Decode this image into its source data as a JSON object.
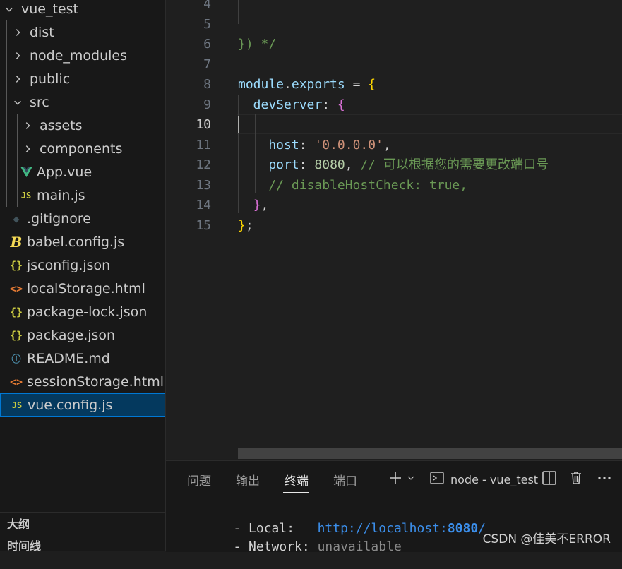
{
  "explorer": {
    "root": "vue_test",
    "items": [
      {
        "label": "dist",
        "type": "folder",
        "icon": "chevron-right-icon"
      },
      {
        "label": "node_modules",
        "type": "folder",
        "icon": "chevron-right-icon"
      },
      {
        "label": "public",
        "type": "folder",
        "icon": "chevron-right-icon"
      },
      {
        "label": "src",
        "type": "folder-open",
        "icon": "chevron-down-icon"
      },
      {
        "label": "assets",
        "type": "folder",
        "icon": "chevron-right-icon"
      },
      {
        "label": "components",
        "type": "folder",
        "icon": "chevron-right-icon"
      },
      {
        "label": "App.vue",
        "type": "file",
        "icon": "vue-file-icon"
      },
      {
        "label": "main.js",
        "type": "file",
        "icon": "js-file-icon",
        "glyph": "JS"
      },
      {
        "label": ".gitignore",
        "type": "file",
        "icon": "git-file-icon",
        "glyph": "◆"
      },
      {
        "label": "babel.config.js",
        "type": "file",
        "icon": "babel-file-icon",
        "glyph": "B"
      },
      {
        "label": "jsconfig.json",
        "type": "file",
        "icon": "json-file-icon",
        "glyph": "{}"
      },
      {
        "label": "localStorage.html",
        "type": "file",
        "icon": "html-file-icon",
        "glyph": "<>"
      },
      {
        "label": "package-lock.json",
        "type": "file",
        "icon": "json-file-icon",
        "glyph": "{}"
      },
      {
        "label": "package.json",
        "type": "file",
        "icon": "json-file-icon",
        "glyph": "{}"
      },
      {
        "label": "README.md",
        "type": "file",
        "icon": "info-file-icon",
        "glyph": "ⓘ"
      },
      {
        "label": "sessionStorage.html",
        "type": "file",
        "icon": "html-file-icon",
        "glyph": "<>"
      },
      {
        "label": "vue.config.js",
        "type": "file",
        "icon": "js-file-icon",
        "glyph": "JS",
        "selected": true
      }
    ],
    "sections": {
      "outline": "大纲",
      "timeline": "时间线"
    }
  },
  "editor": {
    "active_line": "10",
    "lines": [
      {
        "n": "4",
        "tokens": []
      },
      {
        "n": "5",
        "tokens": []
      },
      {
        "n": "6",
        "tokens": [
          {
            "t": "}) */",
            "c": "com"
          }
        ]
      },
      {
        "n": "7",
        "tokens": []
      },
      {
        "n": "8",
        "tokens": [
          {
            "t": "module",
            "c": "var"
          },
          {
            "t": ".",
            "c": "plain"
          },
          {
            "t": "exports",
            "c": "var"
          },
          {
            "t": " = ",
            "c": "op"
          },
          {
            "t": "{",
            "c": "brk1"
          }
        ]
      },
      {
        "n": "9",
        "tokens": [
          {
            "t": "  devServer",
            "c": "prop"
          },
          {
            "t": ": ",
            "c": "plain"
          },
          {
            "t": "{",
            "c": "brk2"
          }
        ]
      },
      {
        "n": "10",
        "tokens": []
      },
      {
        "n": "11",
        "tokens": [
          {
            "t": "    host",
            "c": "prop"
          },
          {
            "t": ": ",
            "c": "plain"
          },
          {
            "t": "'0.0.0.0'",
            "c": "str"
          },
          {
            "t": ",",
            "c": "plain"
          }
        ]
      },
      {
        "n": "12",
        "tokens": [
          {
            "t": "    port",
            "c": "prop"
          },
          {
            "t": ": ",
            "c": "plain"
          },
          {
            "t": "8080",
            "c": "num"
          },
          {
            "t": ", ",
            "c": "plain"
          },
          {
            "t": "// 可以根据您的需要更改端口号",
            "c": "com"
          }
        ]
      },
      {
        "n": "13",
        "tokens": [
          {
            "t": "    // disableHostCheck: true,",
            "c": "com"
          }
        ]
      },
      {
        "n": "14",
        "tokens": [
          {
            "t": "  ",
            "c": "plain"
          },
          {
            "t": "}",
            "c": "brk2"
          },
          {
            "t": ",",
            "c": "plain"
          }
        ]
      },
      {
        "n": "15",
        "tokens": [
          {
            "t": "}",
            "c": "brk1"
          },
          {
            "t": ";",
            "c": "plain"
          }
        ]
      }
    ]
  },
  "panel": {
    "tabs": [
      "问题",
      "输出",
      "终端",
      "端口"
    ],
    "active_tab": "终端",
    "terminal_name": "node - vue_test",
    "output": {
      "local_label": "- Local:",
      "local_url_prefix": "http://localhost:",
      "local_port": "8080",
      "local_url_suffix": "/",
      "network_label": "- Network:",
      "network_value": "unavailable"
    }
  },
  "watermark": "CSDN @佳美不ERROR",
  "colors": {
    "selected_bg": "#04395e",
    "selected_border": "#0078d4",
    "comment": "#6a9955",
    "string": "#ce9178",
    "number": "#b5cea8",
    "property": "#9cdcfe",
    "link": "#3b8eea"
  }
}
